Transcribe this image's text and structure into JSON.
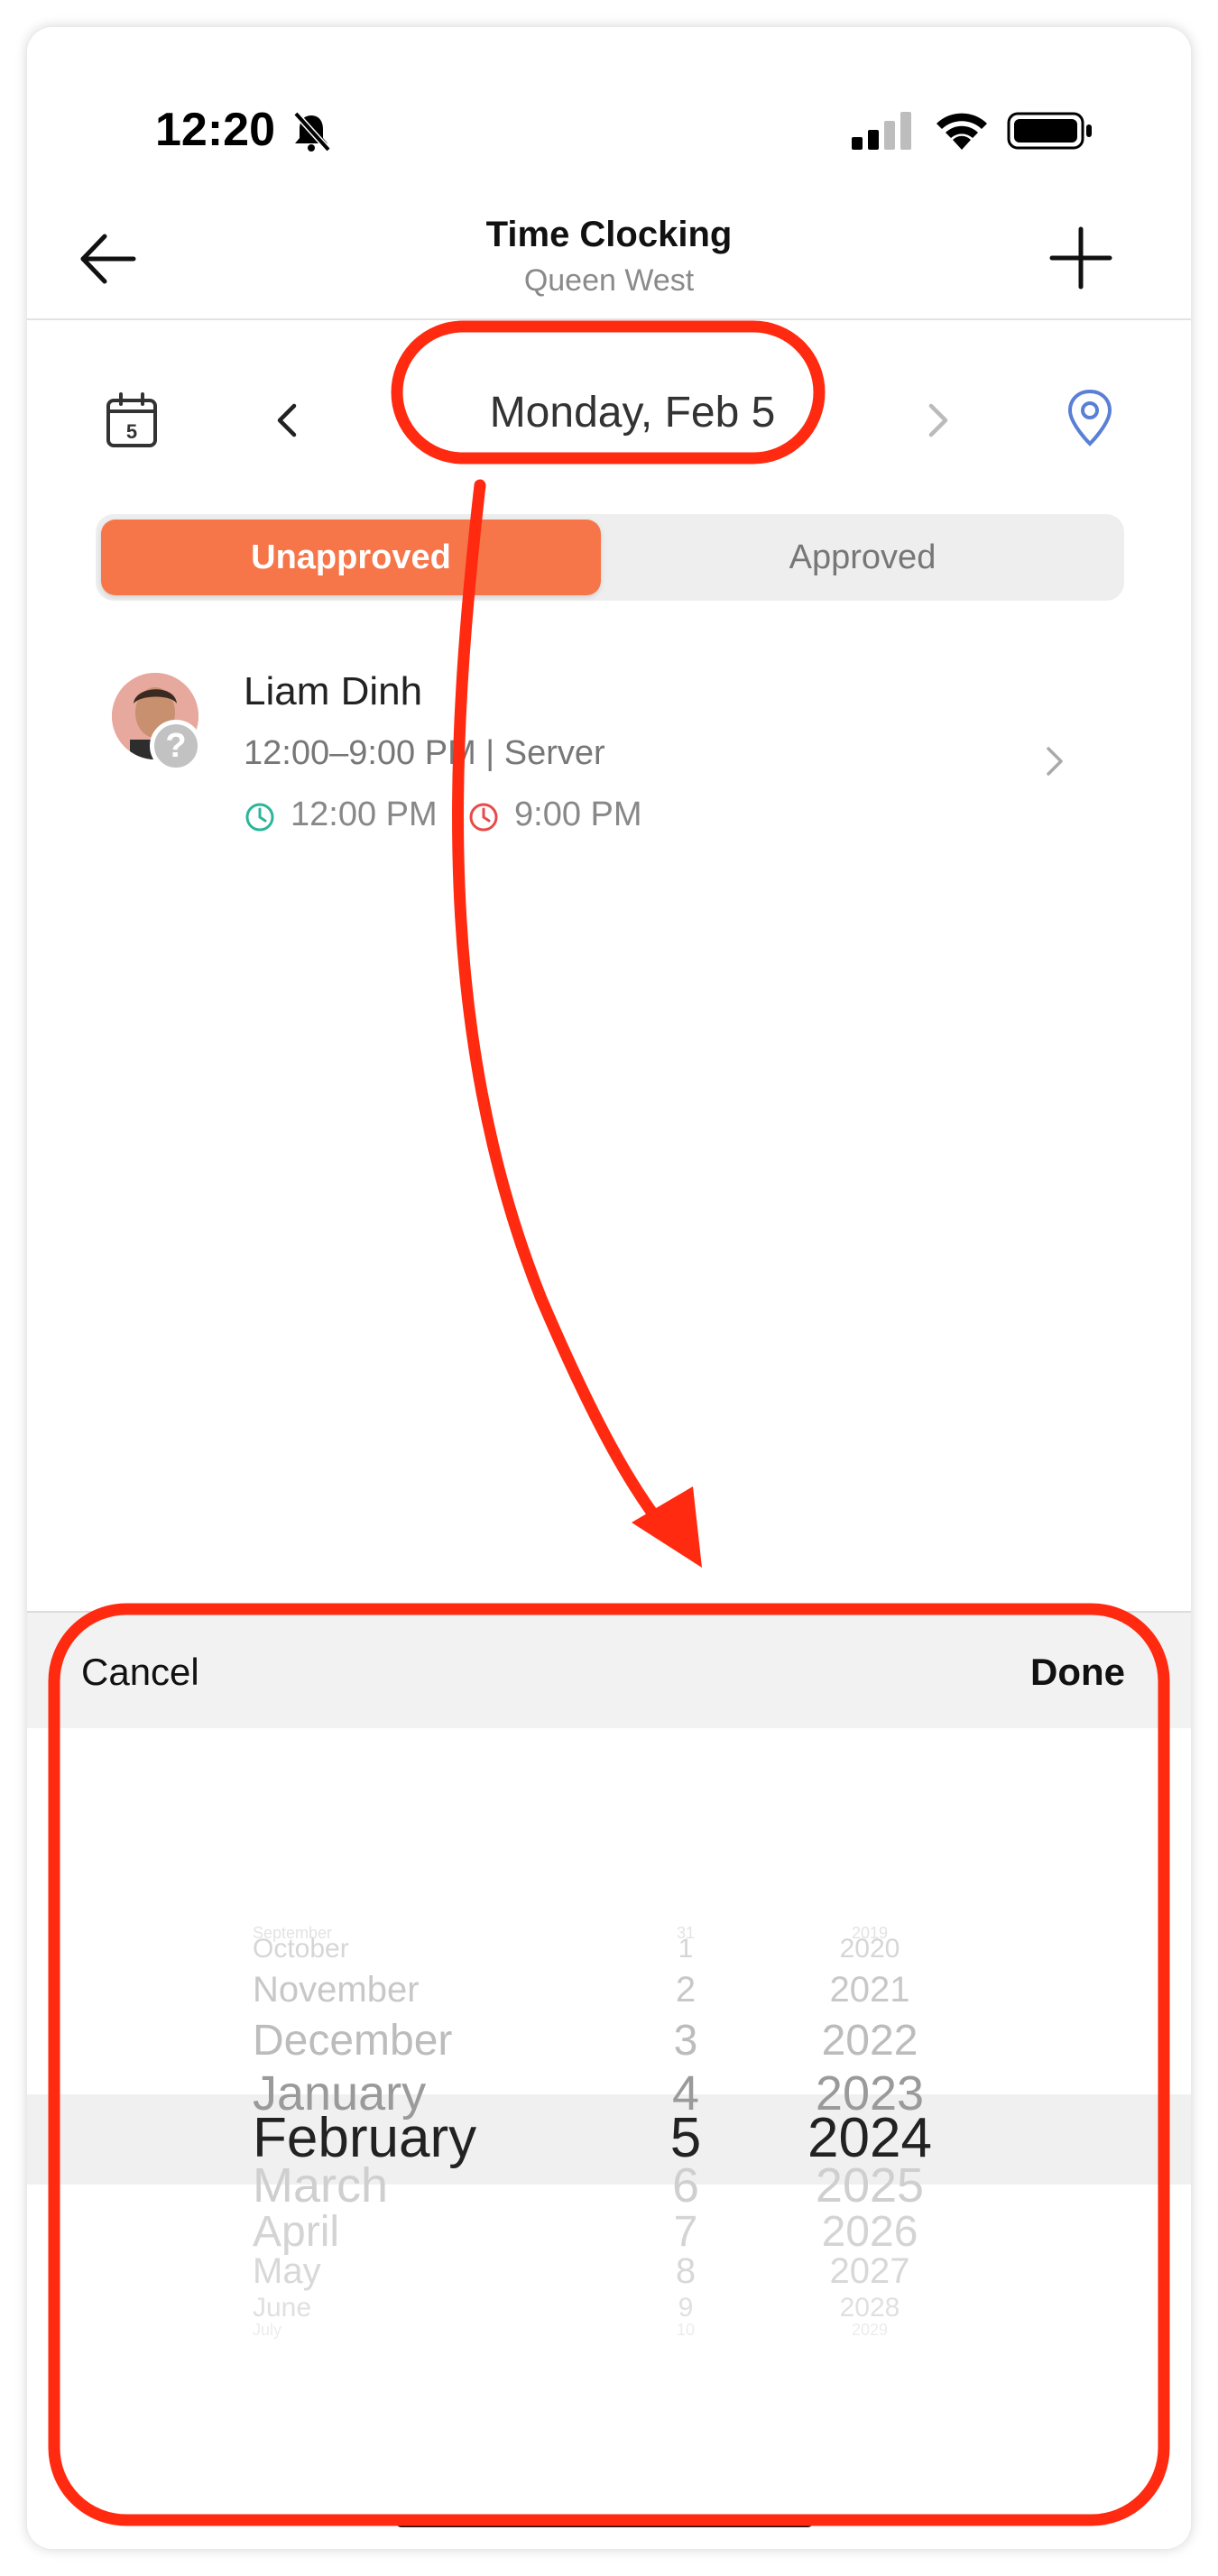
{
  "status_bar": {
    "time": "12:20"
  },
  "header": {
    "title": "Time Clocking",
    "subtitle": "Queen West"
  },
  "date_nav": {
    "calendar_day": "5",
    "date_label": "Monday, Feb 5"
  },
  "tabs": {
    "unapproved": "Unapproved",
    "approved": "Approved",
    "active": "Unapproved"
  },
  "entries": [
    {
      "name": "Liam Dinh",
      "shift": "12:00–9:00 PM | Server",
      "clock_in": "12:00 PM",
      "clock_out": "9:00 PM"
    }
  ],
  "picker": {
    "cancel_label": "Cancel",
    "done_label": "Done",
    "months": [
      "September",
      "October",
      "November",
      "December",
      "January",
      "February",
      "March",
      "April",
      "May",
      "June",
      "July"
    ],
    "days": [
      "31",
      "1",
      "2",
      "3",
      "4",
      "5",
      "6",
      "7",
      "8",
      "9",
      "10"
    ],
    "years": [
      "2019",
      "2020",
      "2021",
      "2022",
      "2023",
      "2024",
      "2025",
      "2026",
      "2027",
      "2028",
      "2029"
    ],
    "selected": {
      "month": "February",
      "day": "5",
      "year": "2024"
    }
  },
  "colors": {
    "accent": "#f6764a",
    "annotation": "#ff2a10",
    "clock_in": "#2bb59a",
    "clock_out": "#e84a4a",
    "location": "#5a7fd6"
  }
}
